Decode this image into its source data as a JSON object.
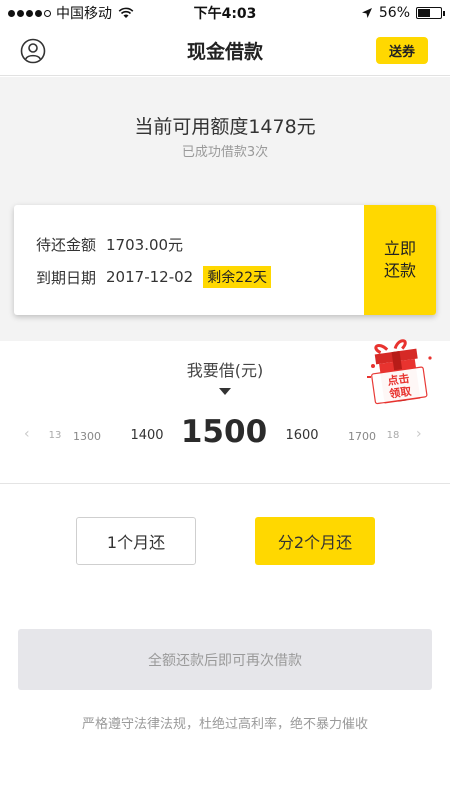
{
  "status_bar": {
    "carrier": "中国移动",
    "time": "下午4:03",
    "battery": "56%",
    "battery_level": 0.56
  },
  "nav": {
    "title": "现金借款",
    "coupon_label": "送券"
  },
  "quota": {
    "main": "当前可用额度1478元",
    "sub": "已成功借款3次"
  },
  "repay_card": {
    "amount_label": "待还金额",
    "amount_value": "1703.00元",
    "due_label": "到期日期",
    "due_value": "2017-12-02",
    "remaining": "剩余22天",
    "button_line1": "立即",
    "button_line2": "还款"
  },
  "borrow": {
    "label": "我要借(元)",
    "gift_text": "点击领取",
    "slider": {
      "left_arrow": "‹",
      "right_arrow": "›",
      "far_left": "13",
      "left2": "1300",
      "left1": "1400",
      "current": "1500",
      "right1": "1600",
      "right2": "1700",
      "far_right": "18"
    }
  },
  "terms": {
    "one_month": "1个月还",
    "two_months": "分2个月还",
    "selected": "two_months"
  },
  "submit": {
    "label": "全额还款后即可再次借款"
  },
  "footer": {
    "note": "严格遵守法律法规，杜绝过高利率，绝不暴力催收"
  },
  "colors": {
    "accent": "#ffd800",
    "background_gray": "#f3f3f3",
    "disabled_button": "#e6e6ea",
    "gift_red": "#e8332f"
  }
}
